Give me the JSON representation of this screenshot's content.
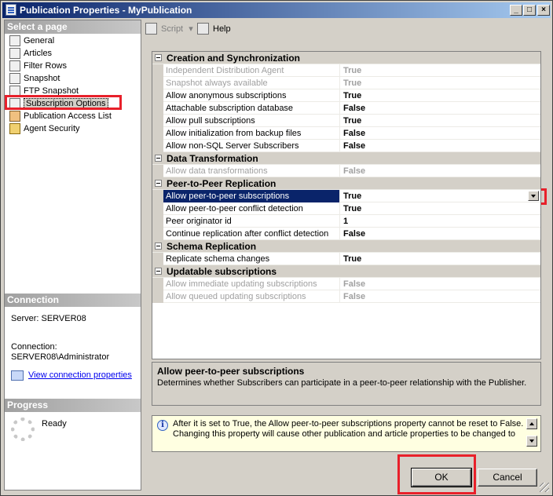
{
  "window": {
    "title": "Publication Properties - MyPublication"
  },
  "left": {
    "select_header": "Select a page",
    "pages": [
      {
        "label": "General",
        "icon": "page-icon"
      },
      {
        "label": "Articles",
        "icon": "page-icon"
      },
      {
        "label": "Filter Rows",
        "icon": "page-icon"
      },
      {
        "label": "Snapshot",
        "icon": "page-icon"
      },
      {
        "label": "FTP Snapshot",
        "icon": "page-icon"
      },
      {
        "label": "Subscription Options",
        "icon": "page-icon",
        "selected": true
      },
      {
        "label": "Publication Access List",
        "icon": "users-icon"
      },
      {
        "label": "Agent Security",
        "icon": "lock-icon"
      }
    ],
    "connection_header": "Connection",
    "server_label": "Server: SERVER08",
    "connection_label": "Connection:",
    "connection_value": "SERVER08\\Administrator",
    "view_connection_link": "View connection properties",
    "progress_header": "Progress",
    "progress_status": "Ready"
  },
  "toolbar": {
    "script_label": "Script",
    "help_label": "Help"
  },
  "grid": {
    "categories": [
      {
        "label": "Creation and Synchronization",
        "rows": [
          {
            "name": "Independent Distribution Agent",
            "value": "True",
            "disabled": true
          },
          {
            "name": "Snapshot always available",
            "value": "True",
            "disabled": true
          },
          {
            "name": "Allow anonymous subscriptions",
            "value": "True"
          },
          {
            "name": "Attachable subscription database",
            "value": "False"
          },
          {
            "name": "Allow pull subscriptions",
            "value": "True"
          },
          {
            "name": "Allow initialization from backup files",
            "value": "False"
          },
          {
            "name": "Allow non-SQL Server Subscribers",
            "value": "False"
          }
        ]
      },
      {
        "label": "Data Transformation",
        "rows": [
          {
            "name": "Allow data transformations",
            "value": "False",
            "disabled": true
          }
        ]
      },
      {
        "label": "Peer-to-Peer Replication",
        "rows": [
          {
            "name": "Allow peer-to-peer subscriptions",
            "value": "True",
            "selected": true
          },
          {
            "name": "Allow peer-to-peer conflict detection",
            "value": "True"
          },
          {
            "name": "Peer originator id",
            "value": "1"
          },
          {
            "name": "Continue replication after conflict detection",
            "value": "False"
          }
        ]
      },
      {
        "label": "Schema Replication",
        "rows": [
          {
            "name": "Replicate schema changes",
            "value": "True"
          }
        ]
      },
      {
        "label": "Updatable subscriptions",
        "rows": [
          {
            "name": "Allow immediate updating subscriptions",
            "value": "False",
            "disabled": true
          },
          {
            "name": "Allow queued updating subscriptions",
            "value": "False",
            "disabled": true
          }
        ]
      }
    ]
  },
  "description": {
    "title": "Allow peer-to-peer subscriptions",
    "text": "Determines whether Subscribers can participate in a peer-to-peer relationship with the Publisher."
  },
  "info": {
    "text": "After it is set to True, the Allow peer-to-peer subscriptions property cannot be reset to False. Changing this property will cause other publication and article properties to be changed to"
  },
  "buttons": {
    "ok_label": "OK",
    "cancel_label": "Cancel"
  }
}
